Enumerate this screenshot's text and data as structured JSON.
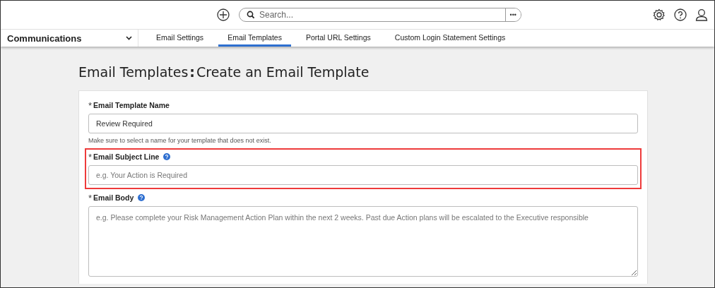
{
  "top_bar": {
    "search": {
      "placeholder": "Search..."
    },
    "more_button": "•••"
  },
  "nav": {
    "module": "Communications",
    "tabs": [
      {
        "label": "Email Settings",
        "selected": false
      },
      {
        "label": "Email Templates",
        "selected": true
      },
      {
        "label": "Portal URL Settings",
        "selected": false
      },
      {
        "label": "Custom Login Statement Settings",
        "selected": false
      }
    ]
  },
  "page_title": {
    "section": "Email Templates",
    "separator": ":",
    "subtitle": "Create an Email Template"
  },
  "form": {
    "fields": [
      {
        "kind": "input",
        "required_mark": "*",
        "label": "Email Template Name",
        "help": false,
        "value": "Review Required",
        "hint": "Make sure to select a name for your template that does not exist.",
        "highlighted": false
      },
      {
        "kind": "input",
        "required_mark": "*",
        "label": "Email Subject Line",
        "help": true,
        "placeholder": "e.g. Your Action is Required",
        "highlighted": true
      },
      {
        "kind": "textarea",
        "required_mark": "*",
        "label": "Email Body",
        "help": true,
        "placeholder": "e.g. Please complete your Risk Management Action Plan within the next 2 weeks. Past due Action plans will be escalated to the Executive responsible",
        "highlighted": false
      }
    ]
  }
}
